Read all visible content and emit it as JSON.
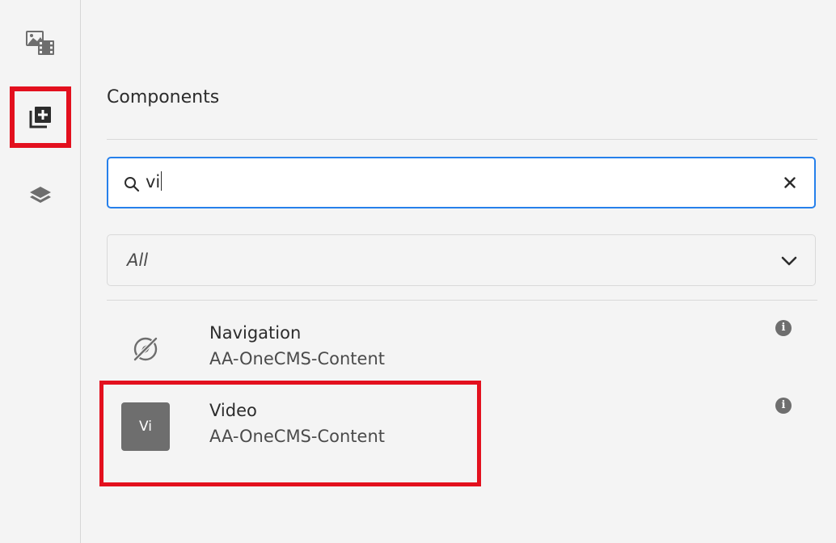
{
  "side_rail": {
    "items": [
      {
        "icon": "assets-icon",
        "selected": false
      },
      {
        "icon": "components-add-icon",
        "selected": true,
        "highlighted": true
      },
      {
        "icon": "layers-icon",
        "selected": false
      }
    ]
  },
  "panel": {
    "title": "Components",
    "search": {
      "value": "vi"
    },
    "filter": {
      "selected": "All"
    },
    "components": [
      {
        "name": "Navigation",
        "group": "AA-OneCMS-Content",
        "icon": "navigation-compass-icon"
      },
      {
        "name": "Video",
        "group": "AA-OneCMS-Content",
        "abbr": "Vi",
        "highlighted": true
      }
    ],
    "info_glyph": "i"
  },
  "colors": {
    "highlight": "#e3101e",
    "focus_border": "#2680eb",
    "background": "#f4f4f4",
    "icon_gray": "#6e6e6e"
  }
}
